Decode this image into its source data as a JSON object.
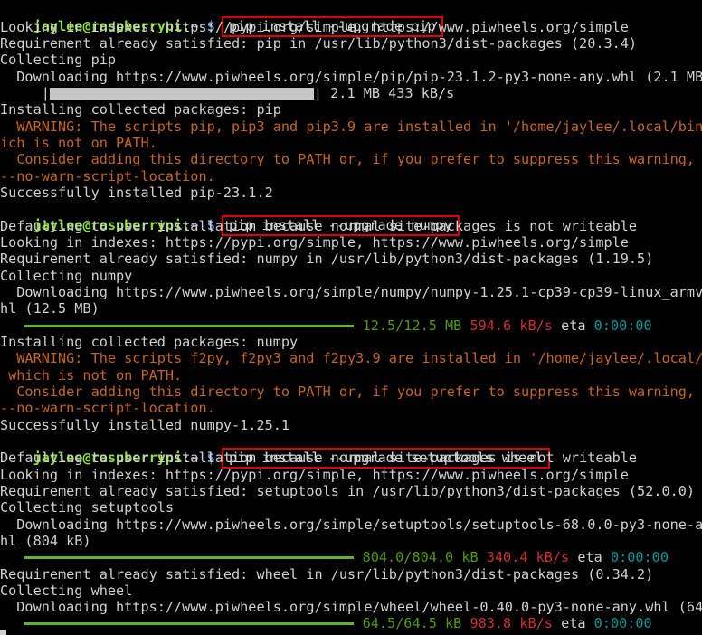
{
  "prompt": {
    "user": "jaylee@raspberrypi",
    "path": "~",
    "symbol": "$"
  },
  "commands": [
    "pip install --upgrade pip",
    "pip install --upgrade numpy",
    "pip install --upgrade setuptools wheel"
  ],
  "lines": {
    "l1": "Looking in indexes: https://pypi.org/simple, https://www.piwheels.org/simple",
    "l2": "Requirement already satisfied: pip in /usr/lib/python3/dist-packages (20.3.4)",
    "l3": "Collecting pip",
    "l4": "  Downloading https://www.piwheels.org/simple/pip/pip-23.1.2-py3-none-any.whl (2.1 MB",
    "l5_pre": "     |",
    "l5_post": "| 2.1 MB 433 kB/s",
    "l6": "Installing collected packages: pip",
    "l7": "  WARNING: The scripts pip, pip3 and pip3.9 are installed in '/home/jaylee/.local/bin",
    "l8": "ich is not on PATH.",
    "l9": "  Consider adding this directory to PATH or, if you prefer to suppress this warning,",
    "l10": "--no-warn-script-location.",
    "l11": "Successfully installed pip-23.1.2",
    "l13": "Defaulting to user installation because normal site-packages is not writeable",
    "l14": "Looking in indexes: https://pypi.org/simple, https://www.piwheels.org/simple",
    "l15": "Requirement already satisfied: numpy in /usr/lib/python3/dist-packages (1.19.5)",
    "l16": "Collecting numpy",
    "l17": "  Downloading https://www.piwheels.org/simple/numpy/numpy-1.25.1-cp39-cp39-linux_armv",
    "l18": "hl (12.5 MB)",
    "l19_size": "12.5/12.5 MB",
    "l19_speed": "594.6 kB/s",
    "l19_eta_label": "eta",
    "l19_eta": "0:00:00",
    "l20": "",
    "l21": "Installing collected packages: numpy",
    "l22": "  WARNING: The scripts f2py, f2py3 and f2py3.9 are installed in '/home/jaylee/.local/",
    "l23": " which is not on PATH.",
    "l24": "  Consider adding this directory to PATH or, if you prefer to suppress this warning,",
    "l25": "--no-warn-script-location.",
    "l26": "Successfully installed numpy-1.25.1",
    "l28": "Defaulting to user installation because normal site-packages is not writeable",
    "l29": "Looking in indexes: https://pypi.org/simple, https://www.piwheels.org/simple",
    "l30": "Requirement already satisfied: setuptools in /usr/lib/python3/dist-packages (52.0.0)",
    "l31": "Collecting setuptools",
    "l32": "  Downloading https://www.piwheels.org/simple/setuptools/setuptools-68.0.0-py3-none-a",
    "l33": "hl (804 kB)",
    "l34_size": "804.0/804.0 kB",
    "l34_speed": "340.4 kB/s",
    "l34_eta_label": "eta",
    "l34_eta": "0:00:00",
    "l35": "Requirement already satisfied: wheel in /usr/lib/python3/dist-packages (0.34.2)",
    "l36": "Collecting wheel",
    "l37": "  Downloading https://www.piwheels.org/simple/wheel/wheel-0.40.0-py3-none-any.whl (64",
    "l38_size": "64.5/64.5 kB",
    "l38_speed": "983.8 kB/s",
    "l38_eta_label": "eta",
    "l38_eta": "0:00:00"
  },
  "progress": {
    "pip": 1.0,
    "numpy": 1.0,
    "setuptools": 1.0,
    "wheel": 1.0
  },
  "colors": {
    "background": "#000000",
    "text": "#d0d0d0",
    "prompt_user": "#8ae234",
    "prompt_path": "#729fcf",
    "warning": "#c4651f",
    "speed": "#cc3030",
    "eta": "#06989a",
    "size": "#4e9a06",
    "highlight_box": "#e00000"
  }
}
